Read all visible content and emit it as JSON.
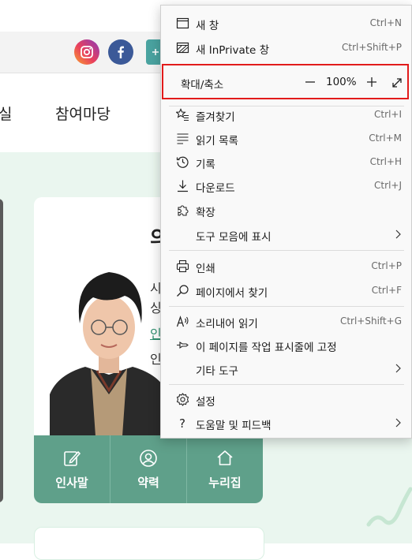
{
  "page": {
    "nav_left_fragment": "실",
    "nav_item": "참여마당",
    "title_fragment": "의",
    "text_line_1": "시",
    "text_line_2": "싱",
    "text_line_3": "인",
    "text_line_4": "인"
  },
  "buttons": [
    {
      "label": "인사말",
      "icon": "pencil-edit-icon"
    },
    {
      "label": "약력",
      "icon": "person-icon"
    },
    {
      "label": "누리집",
      "icon": "home-icon"
    }
  ],
  "menu": {
    "new_window": {
      "label": "새 창",
      "shortcut": "Ctrl+N"
    },
    "new_inprivate": {
      "label": "새 InPrivate 창",
      "shortcut": "Ctrl+Shift+P"
    },
    "zoom": {
      "label": "확대/축소",
      "value": "100%"
    },
    "favorites": {
      "label": "즐겨찾기",
      "shortcut": "Ctrl+I"
    },
    "reading_list": {
      "label": "읽기 목록",
      "shortcut": "Ctrl+M"
    },
    "history": {
      "label": "기록",
      "shortcut": "Ctrl+H"
    },
    "downloads": {
      "label": "다운로드",
      "shortcut": "Ctrl+J"
    },
    "extensions": {
      "label": "확장"
    },
    "show_in_toolbar": {
      "label": "도구 모음에 표시"
    },
    "print": {
      "label": "인쇄",
      "shortcut": "Ctrl+P"
    },
    "find_in_page": {
      "label": "페이지에서 찾기",
      "shortcut": "Ctrl+F"
    },
    "read_aloud": {
      "label": "소리내어 읽기",
      "shortcut": "Ctrl+Shift+G"
    },
    "pin_taskbar": {
      "label": "이 페이지를 작업 표시줄에 고정"
    },
    "more_tools": {
      "label": "기타 도구"
    },
    "settings": {
      "label": "설정"
    },
    "help_feedback": {
      "label": "도움말 및 피드백"
    }
  },
  "colors": {
    "highlight": "#e21b1b",
    "button_green": "#5fa08a",
    "content_bg": "#eaf6ef",
    "facebook": "#3b5998"
  }
}
